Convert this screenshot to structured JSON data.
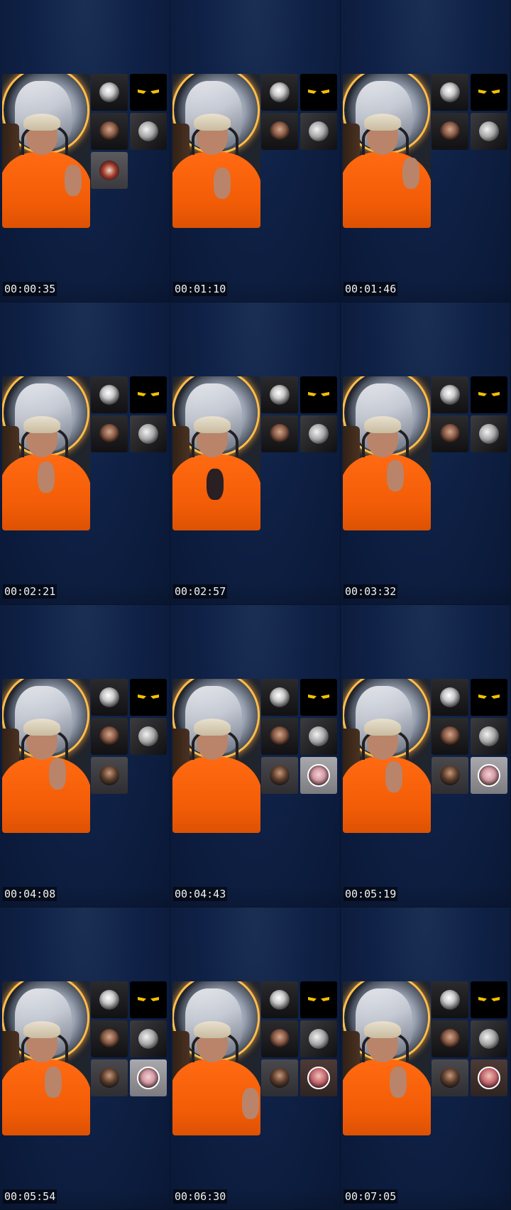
{
  "frames": [
    {
      "timestamp": "00:00:35",
      "participants": [
        "skull",
        "eyes",
        "woman",
        "moon",
        "group"
      ]
    },
    {
      "timestamp": "00:01:10",
      "participants": [
        "skull",
        "eyes",
        "woman",
        "moon"
      ]
    },
    {
      "timestamp": "00:01:46",
      "participants": [
        "skull",
        "eyes",
        "woman",
        "moon"
      ]
    },
    {
      "timestamp": "00:02:21",
      "participants": [
        "skull",
        "eyes",
        "woman",
        "moon"
      ]
    },
    {
      "timestamp": "00:02:57",
      "participants": [
        "skull",
        "eyes",
        "woman",
        "moon"
      ]
    },
    {
      "timestamp": "00:03:32",
      "participants": [
        "skull",
        "eyes",
        "woman",
        "moon"
      ]
    },
    {
      "timestamp": "00:04:08",
      "participants": [
        "skull",
        "eyes",
        "woman",
        "moon",
        "man"
      ]
    },
    {
      "timestamp": "00:04:43",
      "participants": [
        "skull",
        "eyes",
        "woman",
        "moon",
        "man",
        "pink"
      ]
    },
    {
      "timestamp": "00:05:19",
      "participants": [
        "skull",
        "eyes",
        "woman",
        "moon",
        "man",
        "pink"
      ]
    },
    {
      "timestamp": "00:05:54",
      "participants": [
        "skull",
        "eyes",
        "woman",
        "moon",
        "man",
        "pink"
      ]
    },
    {
      "timestamp": "00:06:30",
      "participants": [
        "skull",
        "eyes",
        "woman",
        "moon",
        "man",
        "pink2"
      ]
    },
    {
      "timestamp": "00:07:05",
      "participants": [
        "skull",
        "eyes",
        "woman",
        "moon",
        "man",
        "pink2"
      ]
    }
  ],
  "colors": {
    "background": "#0b1a36",
    "shirt": "#f25c06",
    "halo": "#ffbd4a"
  }
}
